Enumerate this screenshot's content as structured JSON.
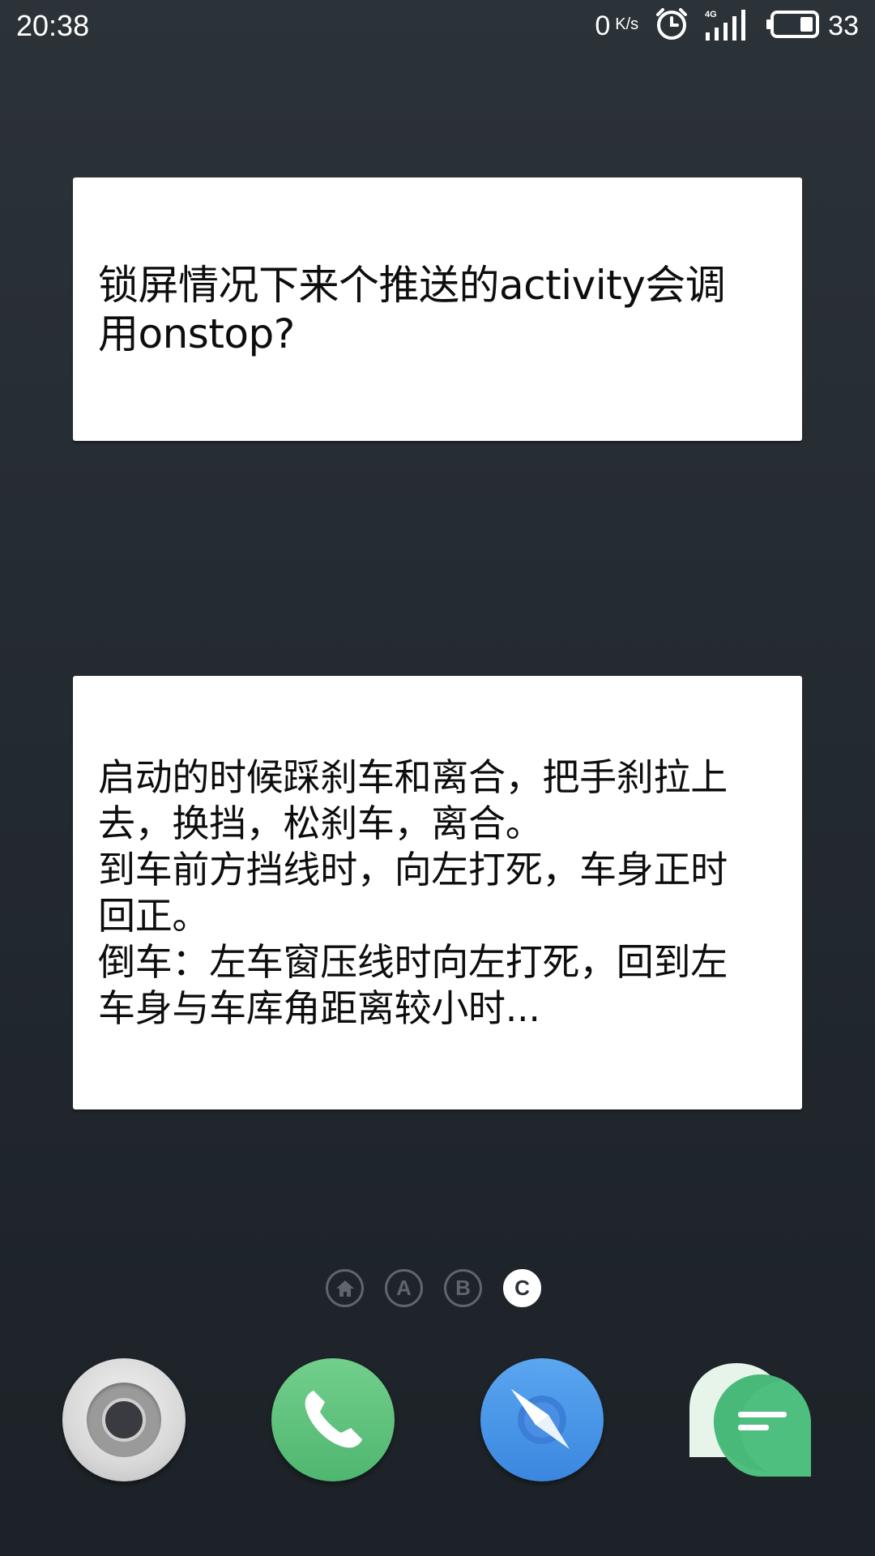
{
  "status_bar": {
    "time": "20:38",
    "net_speed_value": "0",
    "net_speed_unit": "K/s",
    "signal_label": "4G",
    "battery_level": "33",
    "icons": [
      "alarm-clock-icon",
      "signal-4g-icon",
      "battery-icon"
    ]
  },
  "widgets": {
    "card1": {
      "text": "锁屏情况下来个推送的activity会调用onstop?"
    },
    "card2": {
      "text": "启动的时候踩刹车和离合，把手刹拉上去，换挡，松刹车，离合。\n到车前方挡线时，向左打死，车身正时回正。\n倒车：左车窗压线时向左打死，回到左车身与车库角距离较小时..."
    }
  },
  "page_indicator": {
    "home_icon": "home-icon",
    "pages": [
      "A",
      "B",
      "C"
    ],
    "active": "C"
  },
  "dock": {
    "apps": [
      "camera-app",
      "phone-app",
      "browser-app",
      "messages-app"
    ]
  },
  "colors": {
    "background": "#232a30",
    "card": "#ffffff",
    "phone_green": "#5cc27d",
    "browser_blue": "#4a97e8",
    "messages_green": "#4fbf7f"
  }
}
